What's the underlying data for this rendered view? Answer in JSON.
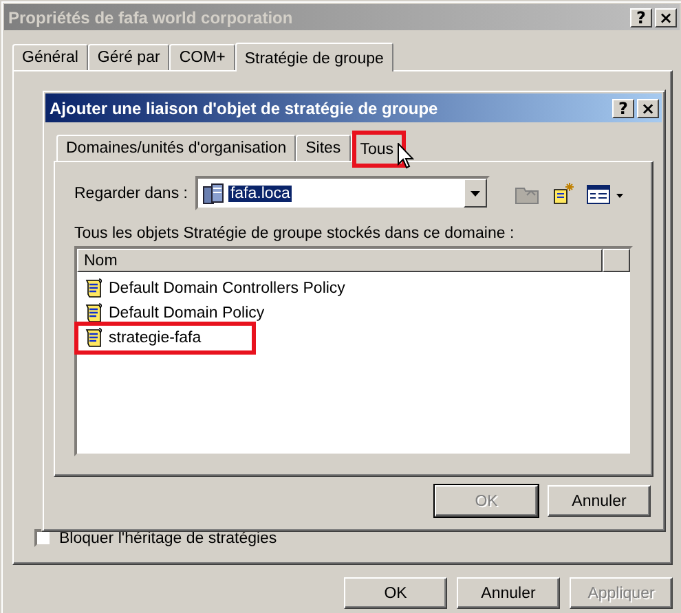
{
  "window": {
    "title": "Propriétés de fafa world corporation",
    "title_buttons": [
      "?",
      "×"
    ]
  },
  "tabs": [
    {
      "label": "Général",
      "selected": false
    },
    {
      "label": "Géré par",
      "selected": false
    },
    {
      "label": "COM+",
      "selected": false
    },
    {
      "label": "Stratégie de groupe",
      "selected": true
    }
  ],
  "block_inheritance": {
    "label": "Bloquer l'héritage de stratégies",
    "checked": false
  },
  "buttons": [
    {
      "label": "OK",
      "disabled": false
    },
    {
      "label": "Annuler",
      "disabled": false
    },
    {
      "label": "Appliquer",
      "disabled": true
    }
  ],
  "dialog": {
    "title": "Ajouter une liaison d'objet de stratégie de groupe",
    "title_buttons": [
      "?",
      "×"
    ],
    "tabs": [
      {
        "label": "Domaines/unités d'organisation",
        "selected": false,
        "highlighted": false
      },
      {
        "label": "Sites",
        "selected": false,
        "highlighted": false
      },
      {
        "label": "Tous",
        "selected": true,
        "highlighted": true
      }
    ],
    "look_in": {
      "label": "Regarder dans :",
      "value": "fafa.loca"
    },
    "list_caption": "Tous les objets Stratégie de groupe stockés dans ce domaine :",
    "list": {
      "columns": [
        "Nom"
      ],
      "rows": [
        {
          "name": "Default Domain Controllers Policy",
          "highlighted": false
        },
        {
          "name": "Default Domain Policy",
          "highlighted": false
        },
        {
          "name": "strategie-fafa",
          "highlighted": true
        }
      ]
    },
    "buttons": [
      {
        "label": "OK",
        "disabled": true,
        "default": true
      },
      {
        "label": "Annuler",
        "disabled": false,
        "default": false
      }
    ]
  }
}
